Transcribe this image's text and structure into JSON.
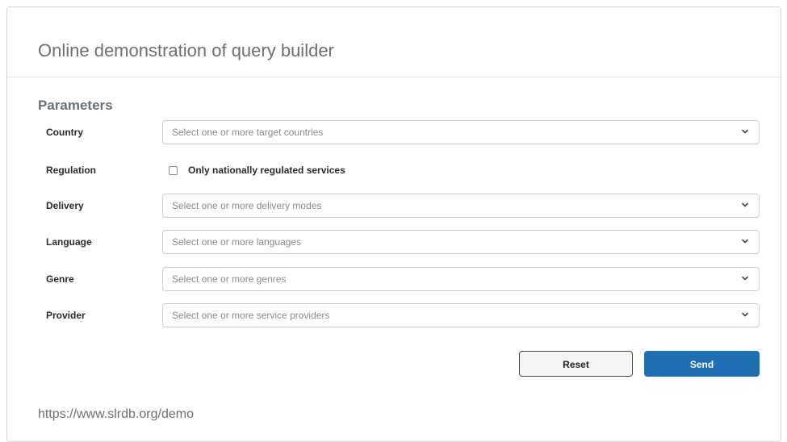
{
  "title": "Online demonstration of query builder",
  "section_title": "Parameters",
  "fields": {
    "country": {
      "label": "Country",
      "placeholder": "Select one or more target countries"
    },
    "regulation": {
      "label": "Regulation",
      "checkbox_label": "Only nationally regulated services",
      "checked": false
    },
    "delivery": {
      "label": "Delivery",
      "placeholder": "Select one or more delivery modes"
    },
    "language": {
      "label": "Language",
      "placeholder": "Select one or more languages"
    },
    "genre": {
      "label": "Genre",
      "placeholder": "Select one or more genres"
    },
    "provider": {
      "label": "Provider",
      "placeholder": "Select one or more service providers"
    }
  },
  "buttons": {
    "reset": "Reset",
    "send": "Send"
  },
  "footer": {
    "url": "https://www.slrdb.org/demo"
  },
  "colors": {
    "primary": "#1f6fb2",
    "section_title": "#6a7077",
    "muted_text": "#6f6f6f"
  },
  "icons": {
    "dropdown": "chevron-down-icon"
  }
}
